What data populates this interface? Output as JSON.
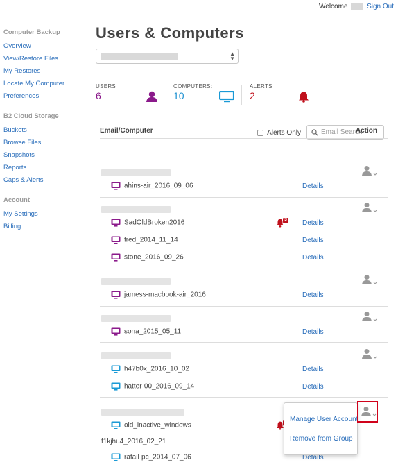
{
  "topbar": {
    "welcome": "Welcome",
    "sign_out": "Sign Out"
  },
  "sidebar": {
    "sections": [
      {
        "title": "Computer Backup",
        "items": [
          "Overview",
          "View/Restore Files",
          "My Restores",
          "Locate My Computer",
          "Preferences"
        ]
      },
      {
        "title": "B2 Cloud Storage",
        "items": [
          "Buckets",
          "Browse Files",
          "Snapshots",
          "Reports",
          "Caps & Alerts"
        ]
      },
      {
        "title": "Account",
        "items": [
          "My Settings",
          "Billing"
        ]
      }
    ]
  },
  "main": {
    "title": "Users & Computers",
    "stats": {
      "users_label": "USERS",
      "users_value": "6",
      "computers_label": "COMPUTERS:",
      "computers_value": "10",
      "alerts_label": "ALERTS",
      "alerts_value": "2"
    },
    "alerts_only_label": "Alerts Only",
    "search_placeholder": "Email Search",
    "table": {
      "col_email": "Email/Computer",
      "col_action": "Action",
      "details_label": "Details"
    },
    "computers": {
      "c1": "ahins-air_2016_09_06",
      "c2": "SadOldBroken2016",
      "c2_alert_count": "3",
      "c3": "fred_2014_11_14",
      "c4": "stone_2016_09_26",
      "c5": "jamess-macbook-air_2016",
      "c6": "sona_2015_05_11",
      "c7": "h47b0x_2016_10_02",
      "c8": "hatter-00_2016_09_14",
      "c9_line1": "old_inactive_windows-",
      "c9_line2": "f1kjhu4_2016_02_21",
      "c10": "rafail-pc_2014_07_06"
    }
  },
  "popup": {
    "manage": "Manage User Account",
    "remove": "Remove from Group"
  },
  "colors": {
    "link": "#2a6ebb",
    "users": "#8b1a8b",
    "computers": "#1a8fd0",
    "alerts": "#c0101c",
    "mac_icon": "#8b1a8b",
    "pc_icon": "#1a9ad6"
  }
}
